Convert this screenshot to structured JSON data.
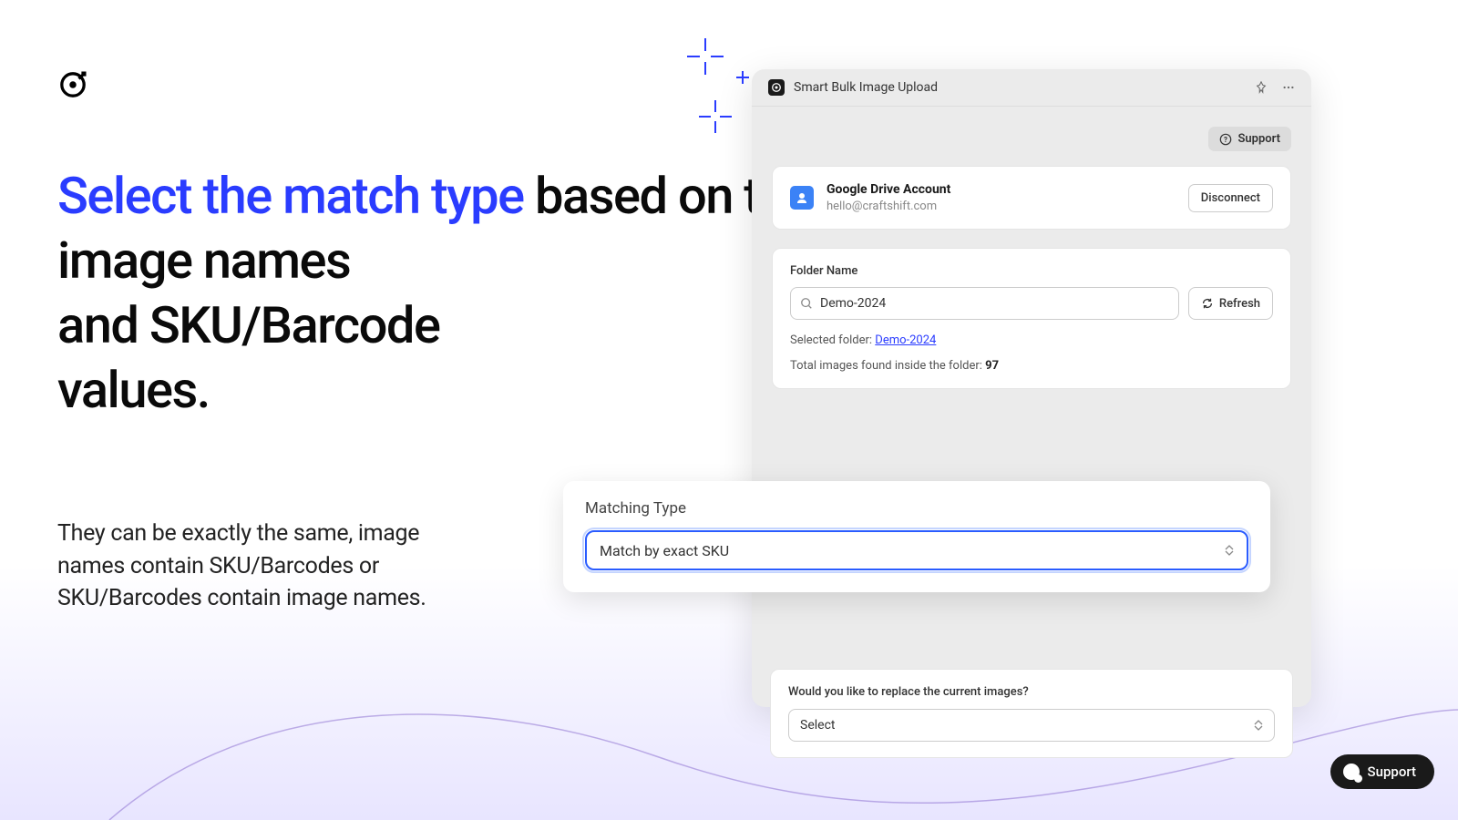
{
  "headline_blue": "Select the match type",
  "headline_rest_1": " based on the",
  "headline_rest_2": "image names",
  "headline_rest_3": "and SKU/Barcode",
  "headline_rest_4": "values.",
  "subtext_1": "They can be exactly the same, image",
  "subtext_2": "names contain SKU/Barcodes or",
  "subtext_3": "SKU/Barcodes contain image names.",
  "app_title": "Smart Bulk Image Upload",
  "support_top_label": "Support",
  "account_title": "Google Drive Account",
  "account_email": "hello@craftshift.com",
  "disconnect_label": "Disconnect",
  "folder_label": "Folder Name",
  "folder_value": "Demo-2024",
  "refresh_label": "Refresh",
  "selected_folder_prefix": "Selected folder: ",
  "selected_folder_link": "Demo-2024",
  "total_images_prefix": "Total images found inside the folder: ",
  "total_images_count": "97",
  "matching_label": "Matching Type",
  "matching_value": "Match by exact SKU",
  "replace_label": "Would you like to replace the current images?",
  "replace_value": "Select",
  "support_pill_label": "Support"
}
